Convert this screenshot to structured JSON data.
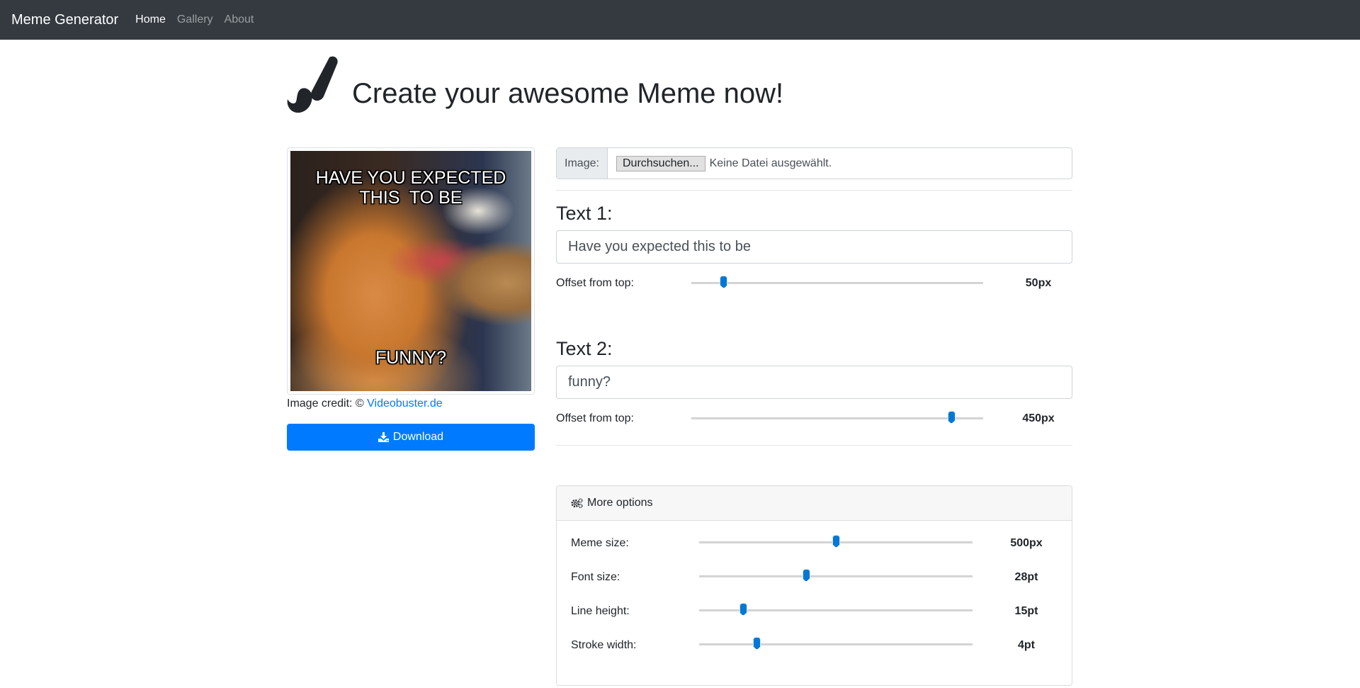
{
  "navbar": {
    "brand": "Meme Generator",
    "links": [
      {
        "label": "Home",
        "active": true
      },
      {
        "label": "Gallery",
        "active": false
      },
      {
        "label": "About",
        "active": false
      }
    ]
  },
  "header": {
    "icon": "paint-brush-icon",
    "title": "Create your awesome Meme now!"
  },
  "preview": {
    "top_text": "HAVE YOU EXPECTED\nTHIS  TO BE",
    "bottom_text": "FUNNY?",
    "credit_label": "Image credit: © ",
    "credit_link": "Videobuster.de",
    "download_label": "Download",
    "download_icon": "download-icon"
  },
  "image_input": {
    "label": "Image:",
    "button_label": "Durchsuchen...",
    "status": "Keine Datei ausgewählt."
  },
  "text1": {
    "label": "Text 1:",
    "value": "Have you expected this to be",
    "offset_label": "Offset from top:",
    "offset_value": "50px",
    "offset_fraction": 0.11
  },
  "text2": {
    "label": "Text 2:",
    "value": "funny?",
    "offset_label": "Offset from top:",
    "offset_value": "450px",
    "offset_fraction": 0.89
  },
  "more_options": {
    "title": "More options",
    "icon": "cogs-icon",
    "rows": [
      {
        "label": "Meme size:",
        "value": "500px",
        "fraction": 0.5
      },
      {
        "label": "Font size:",
        "value": "28pt",
        "fraction": 0.39
      },
      {
        "label": "Line height:",
        "value": "15pt",
        "fraction": 0.16
      },
      {
        "label": "Stroke width:",
        "value": "4pt",
        "fraction": 0.21
      }
    ]
  },
  "colors": {
    "navbar_bg": "#343a40",
    "primary": "#007bff",
    "slider_thumb": "#0078d7"
  }
}
